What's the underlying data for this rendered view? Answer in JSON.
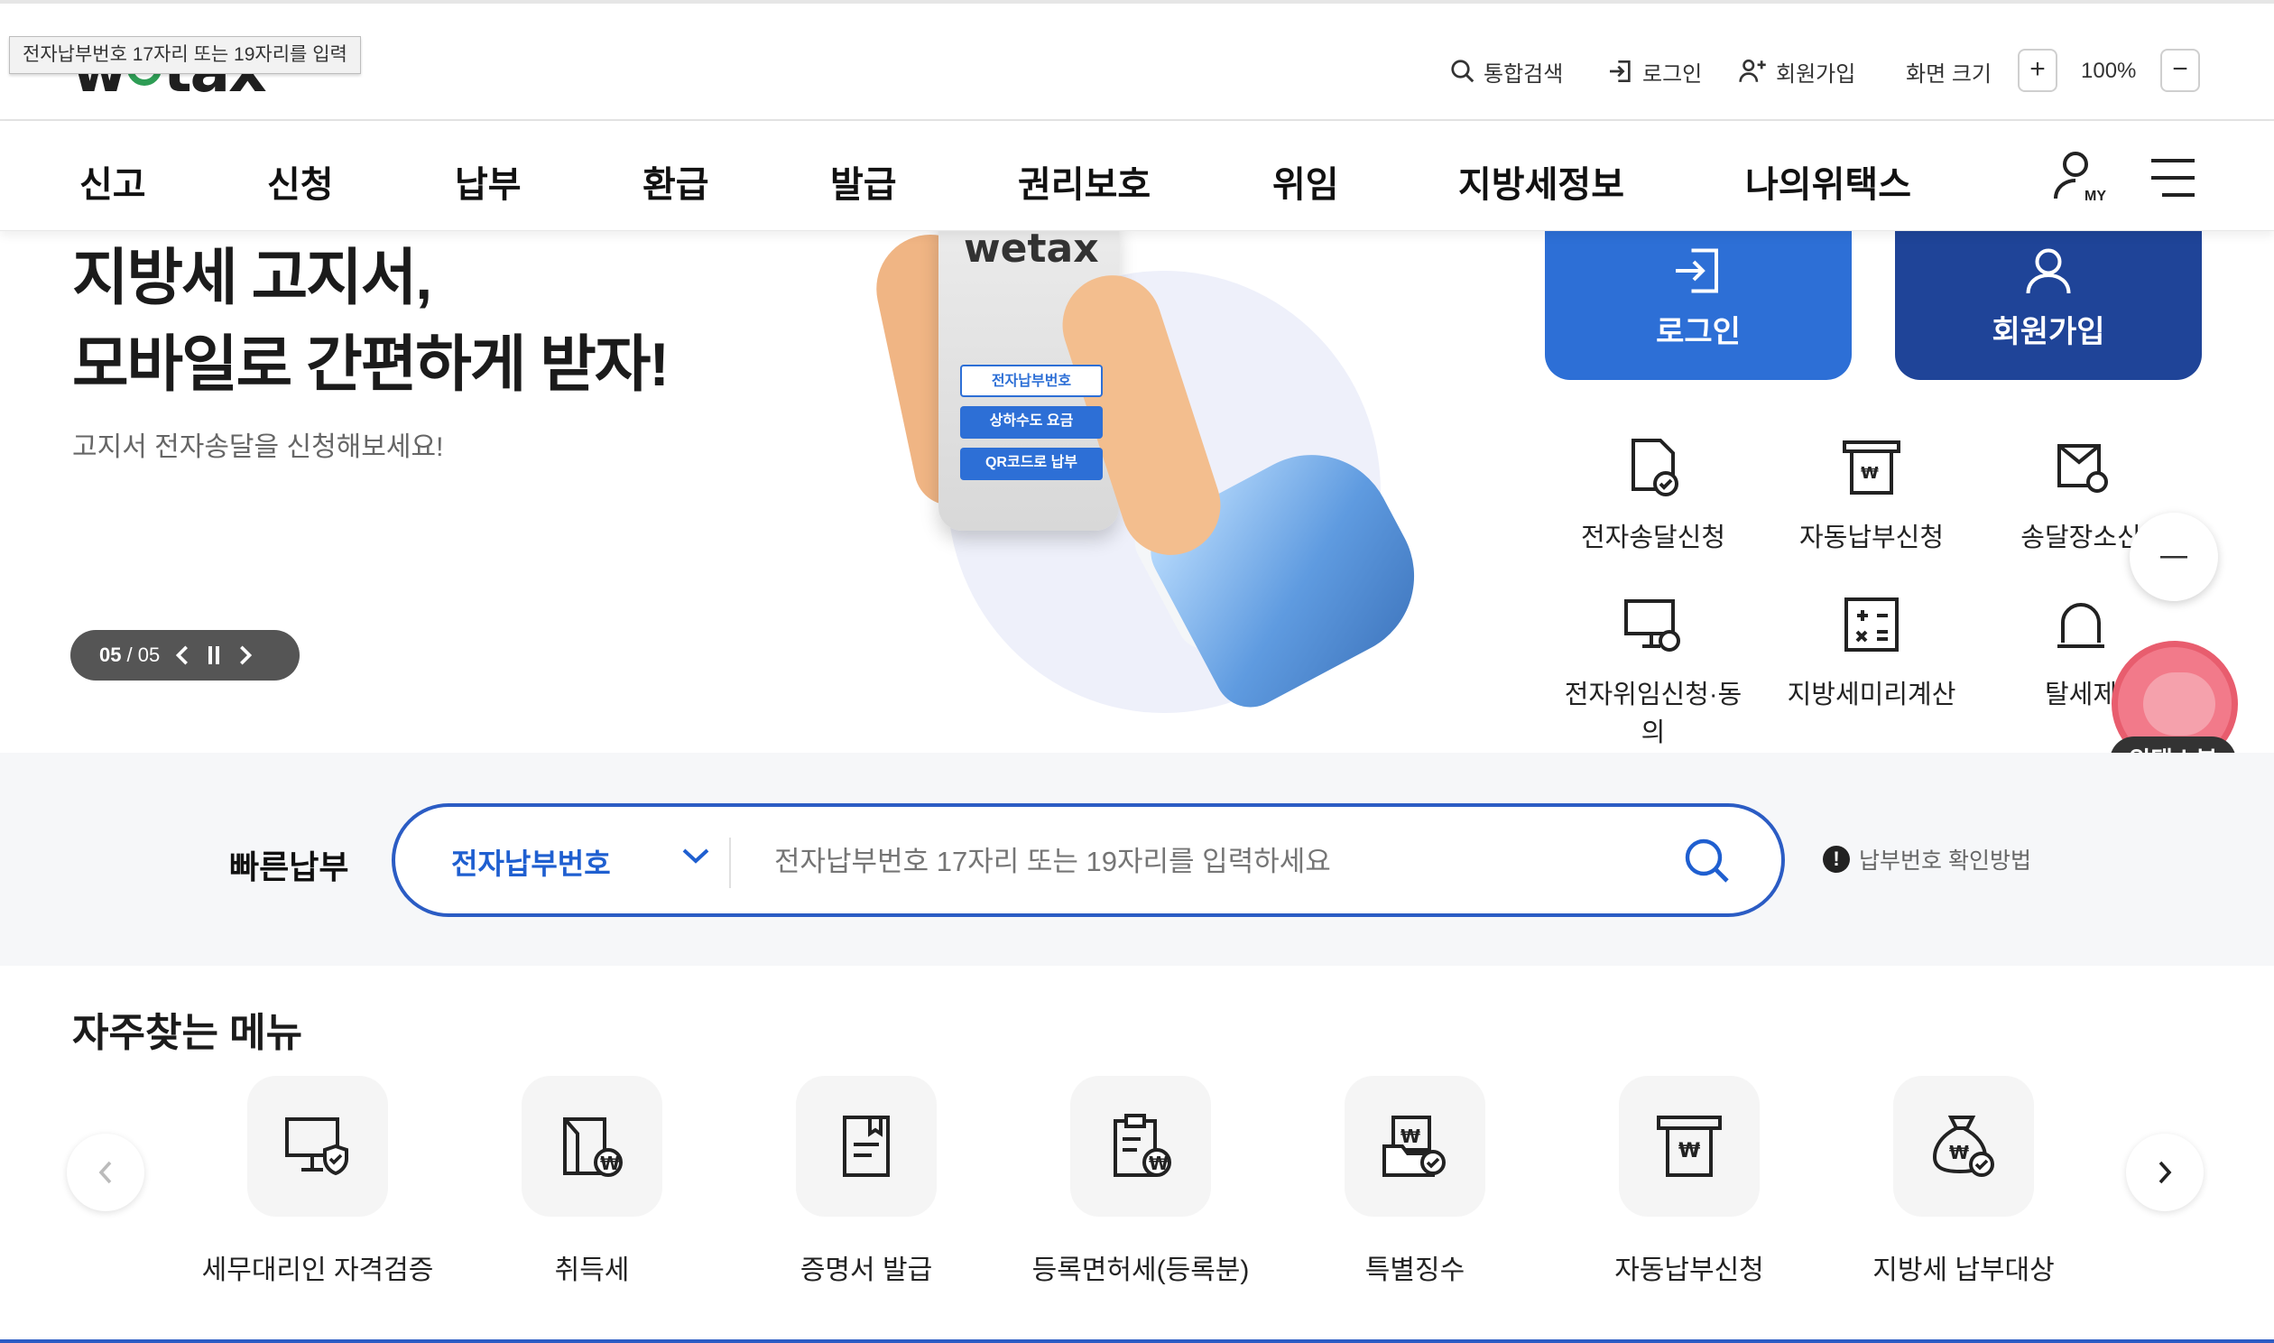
{
  "tooltip": "전자납부번호 17자리 또는 19자리를 입력",
  "header": {
    "logo": "wetax",
    "utility": {
      "search": "통합검색",
      "login": "로그인",
      "signup": "회원가입",
      "screen_size": "화면 크기",
      "zoom_in": "+",
      "zoom_level": "100%",
      "zoom_out": "−"
    }
  },
  "nav": {
    "items": [
      {
        "label": "신고"
      },
      {
        "label": "신청"
      },
      {
        "label": "납부"
      },
      {
        "label": "환급"
      },
      {
        "label": "발급"
      },
      {
        "label": "권리보호"
      },
      {
        "label": "위임"
      },
      {
        "label": "지방세정보"
      },
      {
        "label": "나의위택스"
      }
    ],
    "my_icon": "my-user-icon",
    "menu_icon": "hamburger-icon"
  },
  "hero": {
    "title_line1": "지방세 고지서,",
    "title_line2": "모바일로 간편하게 받자!",
    "subtitle": "고지서 전자송달을 신청해보세요!",
    "pager": {
      "current": "05",
      "total": "/ 05"
    },
    "phone": {
      "logo": "wetax",
      "btn1": "전자납부번호",
      "btn2": "상하수도 요금",
      "btn3": "QR코드로 납부"
    }
  },
  "right_panel": {
    "login_label": "로그인",
    "signup_label": "회원가입",
    "quick": [
      {
        "label": "전자송달신청"
      },
      {
        "label": "자동납부신청"
      },
      {
        "label": "송달장소신"
      },
      {
        "label": "전자위임신청·동의"
      },
      {
        "label": "지방세미리계산"
      },
      {
        "label": "탈세제"
      }
    ]
  },
  "floating": {
    "bot_label": "위택스봇"
  },
  "quick_pay": {
    "label": "빠른납부",
    "select_value": "전자납부번호",
    "placeholder": "전자납부번호 17자리 또는 19자리를 입력하세요",
    "help": "납부번호 확인방법"
  },
  "frequent": {
    "title": "자주찾는 메뉴",
    "items": [
      {
        "label": "세무대리인 자격검증"
      },
      {
        "label": "취득세"
      },
      {
        "label": "증명서 발급"
      },
      {
        "label": "등록면허세(등록분)"
      },
      {
        "label": "특별징수"
      },
      {
        "label": "자동납부신청"
      },
      {
        "label": "지방세 납부대상"
      }
    ]
  },
  "colors": {
    "primary_blue": "#2b5cc4",
    "login_blue": "#2d6fd6",
    "signup_navy": "#1f4498",
    "bot_pink": "#f27a8a"
  }
}
